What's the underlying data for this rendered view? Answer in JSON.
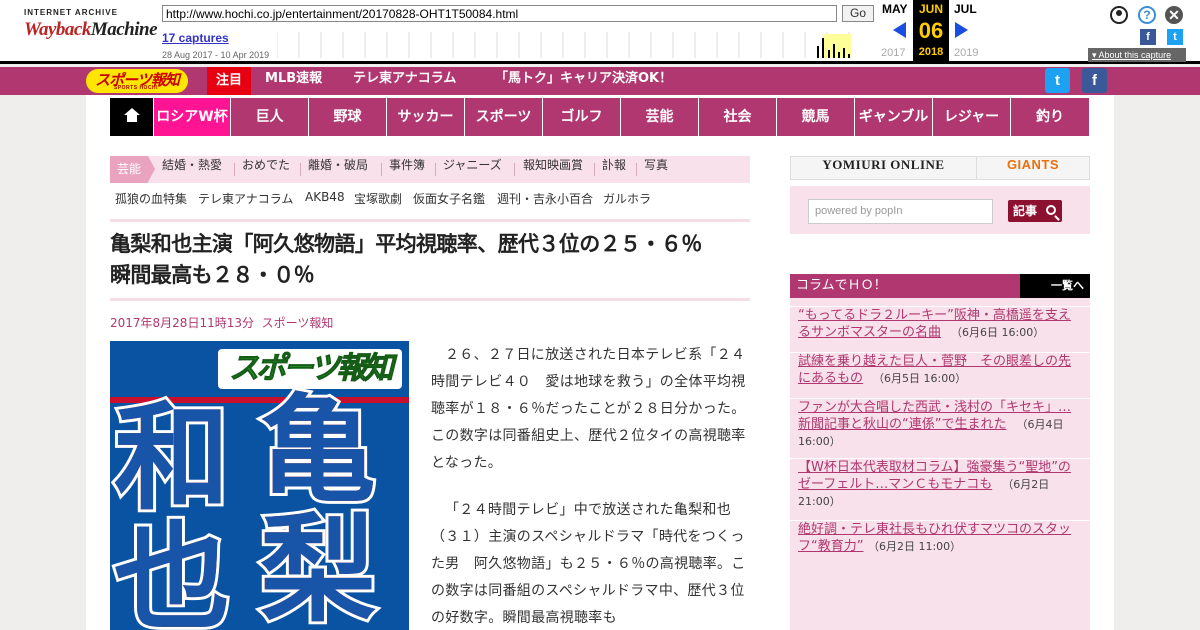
{
  "wayback": {
    "logo_top": "INTERNET ARCHIVE",
    "logo_main_a": "Wayback",
    "logo_main_b": "Machine",
    "url": "http://www.hochi.co.jp/entertainment/20170828-OHT1T50084.html",
    "go_label": "Go",
    "captures": "17 captures",
    "range": "28 Aug 2017 - 10 Apr 2019",
    "prev_month": "MAY",
    "current_month": "JUN",
    "next_month": "JUL",
    "current_day": "06",
    "prev_year": "2017",
    "current_year": "2018",
    "next_year": "2019",
    "about": "About this capture",
    "icons": [
      "user-icon",
      "help-icon",
      "close-icon",
      "facebook-icon",
      "twitter-icon"
    ]
  },
  "topbar": {
    "logo": "スポーツ報知",
    "badge": "注目",
    "links": [
      "MLB速報",
      "テレ東アナコラム",
      "「馬トク」キャリア決済OK！"
    ],
    "colors": {
      "accent": "#b03770",
      "badge": "#e60012",
      "logo_bg": "#ffe600"
    }
  },
  "nav": {
    "items": [
      "ロシアW杯",
      "巨人",
      "野球",
      "サッカー",
      "スポーツ",
      "ゴルフ",
      "芸能",
      "社会",
      "競馬",
      "ギャンブル",
      "レジャー",
      "釣り"
    ]
  },
  "subnav": {
    "label": "芸能",
    "items": [
      "結婚・熱愛",
      "おめでた",
      "離婚・破局",
      "事件簿",
      "ジャニーズ",
      "報知映画賞",
      "訃報",
      "写真"
    ]
  },
  "tags": [
    "孤狼の血特集",
    "テレ東アナコラム",
    "AKB48",
    "宝塚歌劇",
    "仮面女子名鑑",
    "週刊・吉永小百合",
    "ガルホラ"
  ],
  "article": {
    "title": "亀梨和也主演「阿久悠物語」平均視聴率、歴代３位の２５・６％　瞬間最高も２８・０％",
    "date": "2017年8月28日11時13分",
    "source": "スポーツ報知",
    "image_masthead": "スポーツ報知",
    "image_chars": [
      "亀",
      "和",
      "梨",
      "也"
    ],
    "paragraphs": [
      "２６、２７日に放送された日本テレビ系「２４時間テレビ４０　愛は地球を救う」の全体平均視聴率が１８・６％だったことが２８日分かった。この数字は同番組史上、歴代２位タイの高視聴率となった。",
      "「２４時間テレビ」中で放送された亀梨和也（３１）主演のスペシャルドラマ「時代をつくった男　阿久悠物語」も２５・６％の高視聴率。この数字は同番組のスペシャルドラマ中、歴代３位の好数字。瞬間最高視聴率も"
    ]
  },
  "sidebar": {
    "yomiuri": "YOMIURI ONLINE",
    "giants": "GIANTS",
    "search_placeholder": "powered by popIn",
    "search_button": "記事",
    "column_title": "コラムでＨＯ！",
    "column_more": "一覧へ",
    "columns": [
      {
        "title": "“もってるドラ２ルーキー”阪神・高橋遥を支えるサンボマスターの名曲",
        "date": "（6月6日 16:00）"
      },
      {
        "title": "試練を乗り越えた巨人・菅野　その眼差しの先にあるもの",
        "date": "（6月5日 16:00）"
      },
      {
        "title": "ファンが大合唱した西武・浅村の「キセキ」…新聞記事と秋山の“連係”で生まれた",
        "date": "（6月4日 16:00）"
      },
      {
        "title": "【W杯日本代表取材コラム】強豪集う“聖地”のゼーフェルト…マンＣもモナコも",
        "date": "（6月2日 21:00）"
      },
      {
        "title": "絶好調・テレ東社長もひれ伏すマツコのスタッフ“教育力”",
        "date": "（6月2日 11:00）"
      }
    ]
  }
}
